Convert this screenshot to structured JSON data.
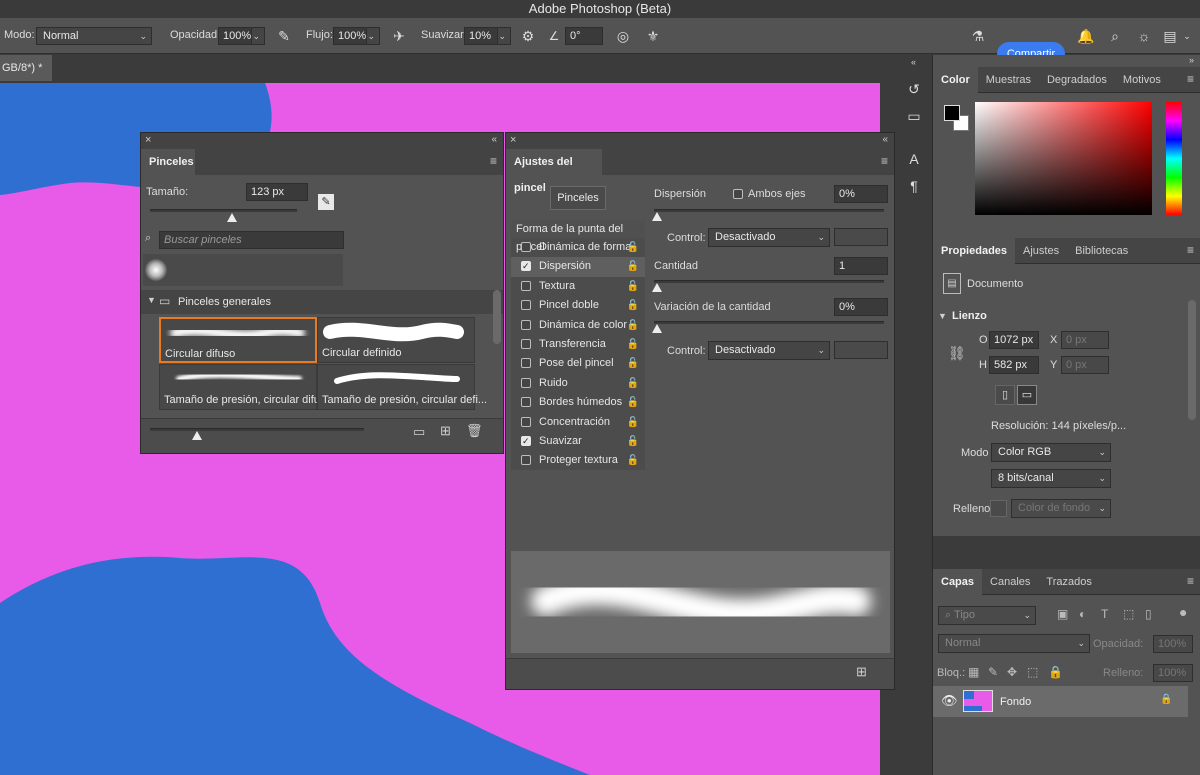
{
  "app_title": "Adobe Photoshop (Beta)",
  "options": {
    "mode_label": "Modo:",
    "mode_value": "Normal",
    "opacity_label": "Opacidad:",
    "opacity_value": "100%",
    "flow_label": "Flujo:",
    "flow_value": "100%",
    "smooth_label": "Suavizar:",
    "smooth_value": "10%",
    "angle_value": "0°",
    "share_label": "Compartir"
  },
  "doc_tab": "GB/8*) *",
  "brushes_panel": {
    "tab": "Pinceles",
    "size_label": "Tamaño:",
    "size_value": "123 px",
    "search_placeholder": "Buscar pinceles",
    "group_name": "Pinceles generales",
    "brushes": [
      {
        "name": "Circular difuso",
        "selected": true
      },
      {
        "name": "Circular definido",
        "selected": false
      },
      {
        "name": "Tamaño de presión, circular difu...",
        "selected": false
      },
      {
        "name": "Tamaño de presión, circular defi...",
        "selected": false
      }
    ]
  },
  "settings_panel": {
    "tab": "Ajustes del pincel",
    "brushes_button": "Pinceles",
    "tip_shape": "Forma de la punta del pincel",
    "options": [
      {
        "label": "Dinámica de forma",
        "checked": false
      },
      {
        "label": "Dispersión",
        "checked": true
      },
      {
        "label": "Textura",
        "checked": false
      },
      {
        "label": "Pincel doble",
        "checked": false
      },
      {
        "label": "Dinámica de color",
        "checked": false
      },
      {
        "label": "Transferencia",
        "checked": false
      },
      {
        "label": "Pose del pincel",
        "checked": false
      },
      {
        "label": "Ruido",
        "checked": false
      },
      {
        "label": "Bordes húmedos",
        "checked": false
      },
      {
        "label": "Concentración",
        "checked": false
      },
      {
        "label": "Suavizar",
        "checked": true
      },
      {
        "label": "Proteger textura",
        "checked": false
      }
    ],
    "scatter_label": "Dispersión",
    "both_axes_label": "Ambos ejes",
    "scatter_value": "0%",
    "control_label": "Control:",
    "control_value": "Desactivado",
    "count_label": "Cantidad",
    "count_value": "1",
    "count_var_label": "Variación de la cantidad",
    "count_var_value": "0%",
    "control2_label": "Control:",
    "control2_value": "Desactivado"
  },
  "color_panel": {
    "tabs": [
      "Color",
      "Muestras",
      "Degradados",
      "Motivos"
    ]
  },
  "props_panel": {
    "tabs": [
      "Propiedades",
      "Ajustes",
      "Bibliotecas"
    ],
    "doc_label": "Documento",
    "canvas_label": "Lienzo",
    "w_label": "O",
    "w_value": "1072 px",
    "x_label": "X",
    "x_value": "0 px",
    "h_label": "H",
    "h_value": "582 px",
    "y_label": "Y",
    "y_value": "0 px",
    "resolution": "Resolución: 144 píxeles/p...",
    "mode_label": "Modo",
    "mode_value": "Color RGB",
    "bits_value": "8 bits/canal",
    "fill_label": "Relleno",
    "fill_value": "Color de fondo"
  },
  "layers_panel": {
    "tabs": [
      "Capas",
      "Canales",
      "Trazados"
    ],
    "type_filter": "Tipo",
    "blend_mode": "Normal",
    "opacity_label": "Opacidad:",
    "opacity_value": "100%",
    "lock_label": "Bloq.:",
    "fill_label": "Relleno:",
    "fill_value": "100%",
    "layer_name": "Fondo"
  }
}
